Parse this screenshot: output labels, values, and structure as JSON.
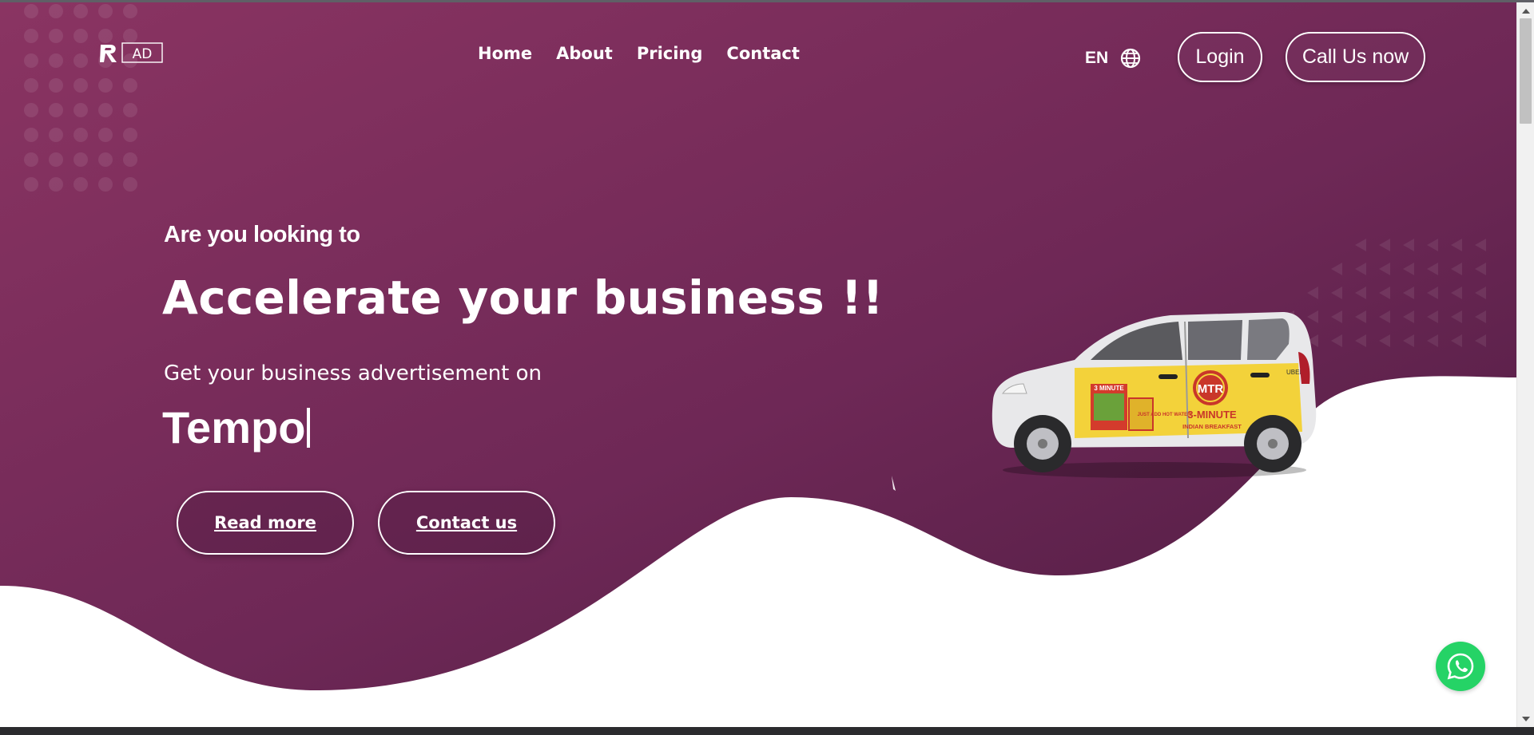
{
  "brand": {
    "logo_text": "AD"
  },
  "nav": {
    "items": [
      {
        "label": "Home"
      },
      {
        "label": "About"
      },
      {
        "label": "Pricing"
      },
      {
        "label": "Contact"
      }
    ]
  },
  "language": {
    "code": "EN",
    "icon": "globe-icon"
  },
  "header_buttons": {
    "login_label": "Login",
    "call_label": "Call Us now"
  },
  "hero": {
    "kicker": "Are you looking to",
    "headline": "Accelerate your business !!",
    "subline": "Get your business advertisement on",
    "typed_word": "Tempo"
  },
  "cta": {
    "read_more_label": "Read more",
    "contact_label": "Contact us"
  },
  "car_ad": {
    "brand": "MTR",
    "tagline": "3-MINUTE",
    "subtag": "INDIAN BREAKFAST",
    "side_text": "UBER",
    "pack_label": "3 MINUTE",
    "pack_note": "JUST ADD HOT WATER"
  },
  "floating": {
    "whatsapp_icon": "whatsapp-icon"
  },
  "colors": {
    "hero_top": "#8a3462",
    "hero_bottom": "#5a2148",
    "accent_white": "#ffffff",
    "whatsapp_green": "#25d366"
  }
}
